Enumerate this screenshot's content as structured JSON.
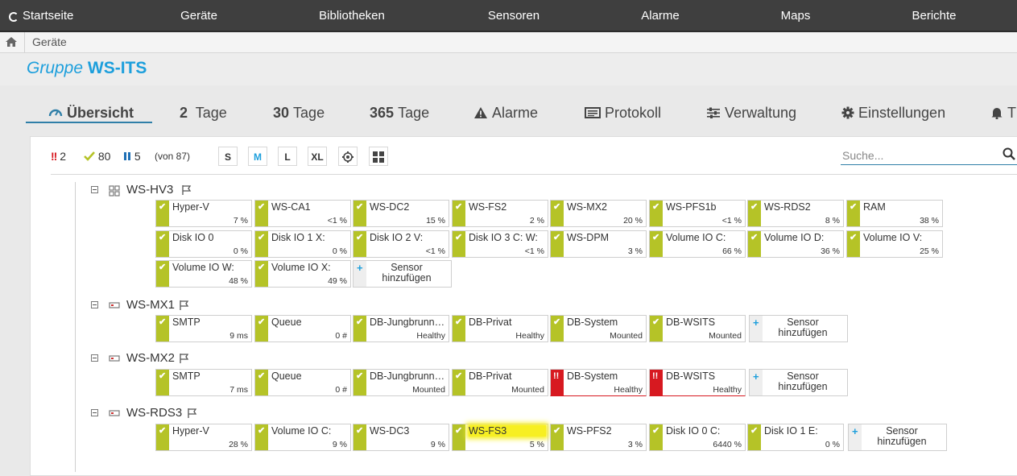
{
  "nav": {
    "items": [
      "Startseite",
      "Geräte",
      "Bibliotheken",
      "Sensoren",
      "Alarme",
      "Maps",
      "Berichte"
    ]
  },
  "breadcrumb": {
    "current": "Geräte"
  },
  "page": {
    "title_prefix": "Gruppe",
    "title_name": "WS-ITS"
  },
  "tabs": {
    "overview": "Übersicht",
    "days2_num": "2",
    "days2_label": "Tage",
    "days30_num": "30",
    "days30_label": "Tage",
    "days365_num": "365",
    "days365_label": "Tage",
    "alarms": "Alarme",
    "log": "Protokoll",
    "manage": "Verwaltung",
    "settings": "Einstellungen",
    "truncated": "T"
  },
  "toolbar": {
    "count_error_icon": "!!",
    "count_error": "2",
    "count_ok": "80",
    "count_paused": "5",
    "count_total": "(von 87)",
    "size_s": "S",
    "size_m": "M",
    "size_l": "L",
    "size_xl": "XL",
    "search_placeholder": "Suche..."
  },
  "colors": {
    "ok": "#b5c327",
    "error": "#d71920",
    "accent": "#1d9fdc",
    "nav_bg": "#3f3f3f",
    "highlight": "#f7ef22"
  },
  "groups": [
    {
      "name": "WS-HV3",
      "icon": "device-group-icon",
      "sensors": [
        {
          "name": "Hyper-V",
          "value": "7 %",
          "status": "ok"
        },
        {
          "name": "WS-CA1",
          "value": "<1 %",
          "status": "ok"
        },
        {
          "name": "WS-DC2",
          "value": "15 %",
          "status": "ok"
        },
        {
          "name": "WS-FS2",
          "value": "2 %",
          "status": "ok"
        },
        {
          "name": "WS-MX2",
          "value": "20 %",
          "status": "ok"
        },
        {
          "name": "WS-PFS1b",
          "value": "<1 %",
          "status": "ok"
        },
        {
          "name": "WS-RDS2",
          "value": "8 %",
          "status": "ok"
        },
        {
          "name": "RAM",
          "value": "38 %",
          "status": "ok"
        },
        {
          "name": "Disk IO 0",
          "value": "0 %",
          "status": "ok"
        },
        {
          "name": "Disk IO 1 X:",
          "value": "0 %",
          "status": "ok"
        },
        {
          "name": "Disk IO 2 V:",
          "value": "<1 %",
          "status": "ok"
        },
        {
          "name": "Disk IO 3 C: W:",
          "value": "<1 %",
          "status": "ok"
        },
        {
          "name": "WS-DPM",
          "value": "3 %",
          "status": "ok"
        },
        {
          "name": "Volume IO C:",
          "value": "66 %",
          "status": "ok"
        },
        {
          "name": "Volume IO D:",
          "value": "36 %",
          "status": "ok"
        },
        {
          "name": "Volume IO V:",
          "value": "25 %",
          "status": "ok"
        },
        {
          "name": "Volume IO W:",
          "value": "48 %",
          "status": "ok"
        },
        {
          "name": "Volume IO X:",
          "value": "49 %",
          "status": "ok"
        },
        {
          "name": "Sensor hinzufügen",
          "value": "",
          "status": "add"
        }
      ]
    },
    {
      "name": "WS-MX1",
      "icon": "server-icon",
      "sensors": [
        {
          "name": "SMTP",
          "value": "9 ms",
          "status": "ok"
        },
        {
          "name": "Queue",
          "value": "0 #",
          "status": "ok"
        },
        {
          "name": "DB-Jungbrunn…",
          "value": "Healthy",
          "status": "ok"
        },
        {
          "name": "DB-Privat",
          "value": "Healthy",
          "status": "ok"
        },
        {
          "name": "DB-System",
          "value": "Mounted",
          "status": "ok"
        },
        {
          "name": "DB-WSITS",
          "value": "Mounted",
          "status": "ok"
        },
        {
          "name": "Sensor hinzufügen",
          "value": "",
          "status": "add"
        }
      ]
    },
    {
      "name": "WS-MX2",
      "icon": "server-icon",
      "sensors": [
        {
          "name": "SMTP",
          "value": "7 ms",
          "status": "ok"
        },
        {
          "name": "Queue",
          "value": "0 #",
          "status": "ok"
        },
        {
          "name": "DB-Jungbrunn…",
          "value": "Mounted",
          "status": "ok"
        },
        {
          "name": "DB-Privat",
          "value": "Mounted",
          "status": "ok"
        },
        {
          "name": "DB-System",
          "value": "Healthy",
          "status": "error"
        },
        {
          "name": "DB-WSITS",
          "value": "Healthy",
          "status": "error"
        },
        {
          "name": "Sensor hinzufügen",
          "value": "",
          "status": "add"
        }
      ]
    },
    {
      "name": "WS-RDS3",
      "icon": "server-icon",
      "sensors": [
        {
          "name": "Hyper-V",
          "value": "28 %",
          "status": "ok"
        },
        {
          "name": "Volume IO C:",
          "value": "9 %",
          "status": "ok"
        },
        {
          "name": "WS-DC3",
          "value": "9 %",
          "status": "ok"
        },
        {
          "name": "WS-FS3",
          "value": "5 %",
          "status": "ok",
          "highlight": true
        },
        {
          "name": "WS-PFS2",
          "value": "3 %",
          "status": "ok"
        },
        {
          "name": "Disk IO 0 C:",
          "value": "6440 %",
          "status": "ok"
        },
        {
          "name": "Disk IO 1 E:",
          "value": "0 %",
          "status": "ok"
        },
        {
          "name": "Sensor hinzufügen",
          "value": "",
          "status": "add"
        }
      ]
    }
  ]
}
